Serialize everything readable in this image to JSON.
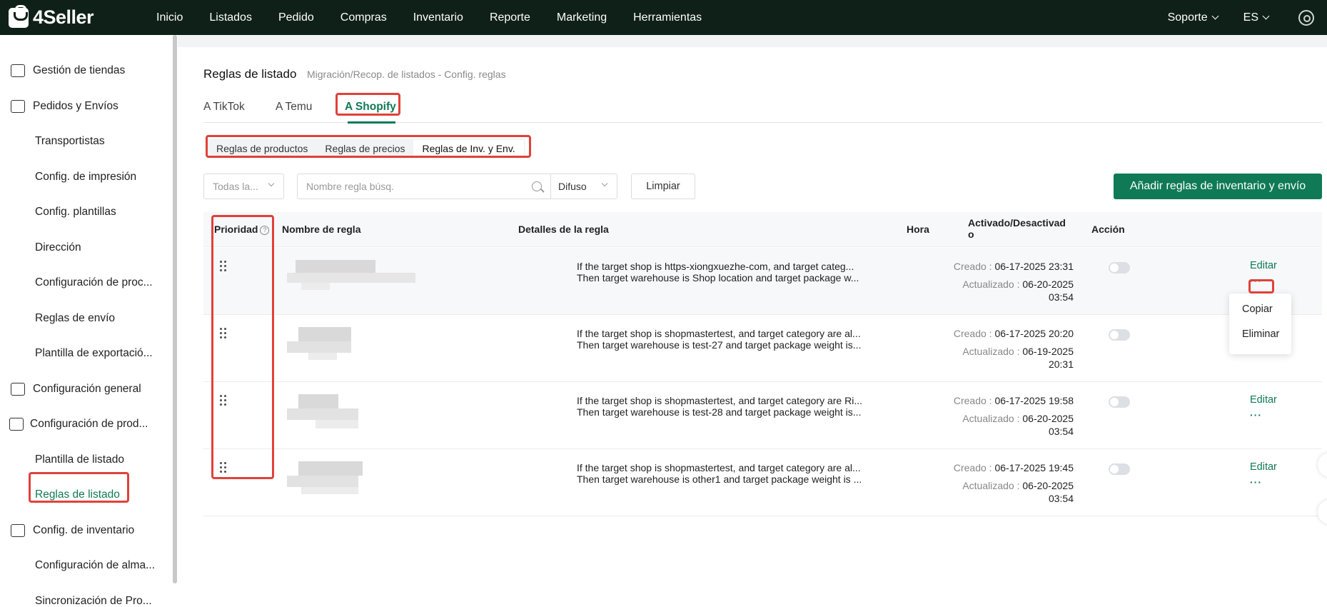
{
  "brand": {
    "name": "4Seller",
    "accent": "#0f7a55",
    "nav_bg": "#0f2018",
    "highlight": "#e0413a"
  },
  "topnav": {
    "items": [
      "Inicio",
      "Listados",
      "Pedido",
      "Compras",
      "Inventario",
      "Reporte",
      "Marketing",
      "Herramientas"
    ],
    "support": "Soporte",
    "lang": "ES",
    "settings_icon": "gear-icon"
  },
  "sidebar": {
    "items": [
      {
        "label": "Gestión de tiendas",
        "icon": "store-icon",
        "level": 1
      },
      {
        "label": "Pedidos y Envíos",
        "icon": "bag-icon",
        "level": 1
      },
      {
        "label": "Transportistas",
        "level": 2
      },
      {
        "label": "Config. de impresión",
        "level": 2
      },
      {
        "label": "Config. plantillas",
        "level": 2
      },
      {
        "label": "Dirección",
        "level": 2
      },
      {
        "label": "Configuración de proc...",
        "level": 2
      },
      {
        "label": "Reglas de envío",
        "level": 2
      },
      {
        "label": "Plantilla de exportació...",
        "level": 2
      },
      {
        "label": "Configuración general",
        "icon": "printer-icon",
        "level": 1
      },
      {
        "label": "Configuración de prod...",
        "icon": "upload-box-icon",
        "level": 1
      },
      {
        "label": "Plantilla de listado",
        "level": 2
      },
      {
        "label": "Reglas de listado",
        "level": 2,
        "active": true
      },
      {
        "label": "Config. de inventario",
        "icon": "warehouse-icon",
        "level": 1
      },
      {
        "label": "Configuración de alma...",
        "level": 2
      },
      {
        "label": "Sincronización de Pro...",
        "level": 2
      }
    ]
  },
  "page": {
    "title": "Reglas de listado",
    "breadcrumb": "Migración/Recop. de listados - Config. reglas",
    "tabs": [
      "A TikTok",
      "A Temu",
      "A Shopify"
    ],
    "active_tab": "A Shopify",
    "subtabs": [
      "Reglas de productos",
      "Reglas de precios",
      "Reglas de Inv. y Env."
    ],
    "active_subtab": "Reglas de Inv. y Env.",
    "filter_select": "Todas la...",
    "search_placeholder": "Nombre regla búsq.",
    "search_mode": "Difuso",
    "clear_label": "Limpiar",
    "add_label": "Añadir reglas de inventario y envío"
  },
  "table": {
    "headers": {
      "priority": "Prioridad",
      "name": "Nombre de regla",
      "details": "Detalles de la regla",
      "time": "Hora",
      "status_line1": "Activado/Desactivad",
      "status_line2": "o",
      "action": "Acción"
    },
    "created_label": "Creado :",
    "updated_label": "Actualizado :",
    "edit_label": "Editar",
    "more_label": "···",
    "rows": [
      {
        "details_1": "If the target shop is https-xiongxuezhe-com, and target categ...",
        "details_2": "Then target warehouse is Shop location and target package w...",
        "created": "06-17-2025 23:31",
        "updated_date": "06-20-2025",
        "updated_time": "03:54",
        "enabled": false
      },
      {
        "details_1": "If the target shop is shopmastertest, and target category are al...",
        "details_2": "Then target warehouse is test-27 and target package weight is...",
        "created": "06-17-2025 20:20",
        "updated_date": "06-19-2025",
        "updated_time": "20:31",
        "enabled": false
      },
      {
        "details_1": "If the target shop is shopmastertest, and target category are Ri...",
        "details_2": "Then target warehouse is test-28 and target package weight is...",
        "created": "06-17-2025 19:58",
        "updated_date": "06-20-2025",
        "updated_time": "03:54",
        "enabled": false
      },
      {
        "details_1": "If the target shop is shopmastertest, and target category are al...",
        "details_2": "Then target warehouse is other1 and target package weight is ...",
        "created": "06-17-2025 19:45",
        "updated_date": "06-20-2025",
        "updated_time": "03:54",
        "enabled": false
      }
    ]
  },
  "popover": {
    "items": [
      "Copiar",
      "Eliminar"
    ]
  }
}
